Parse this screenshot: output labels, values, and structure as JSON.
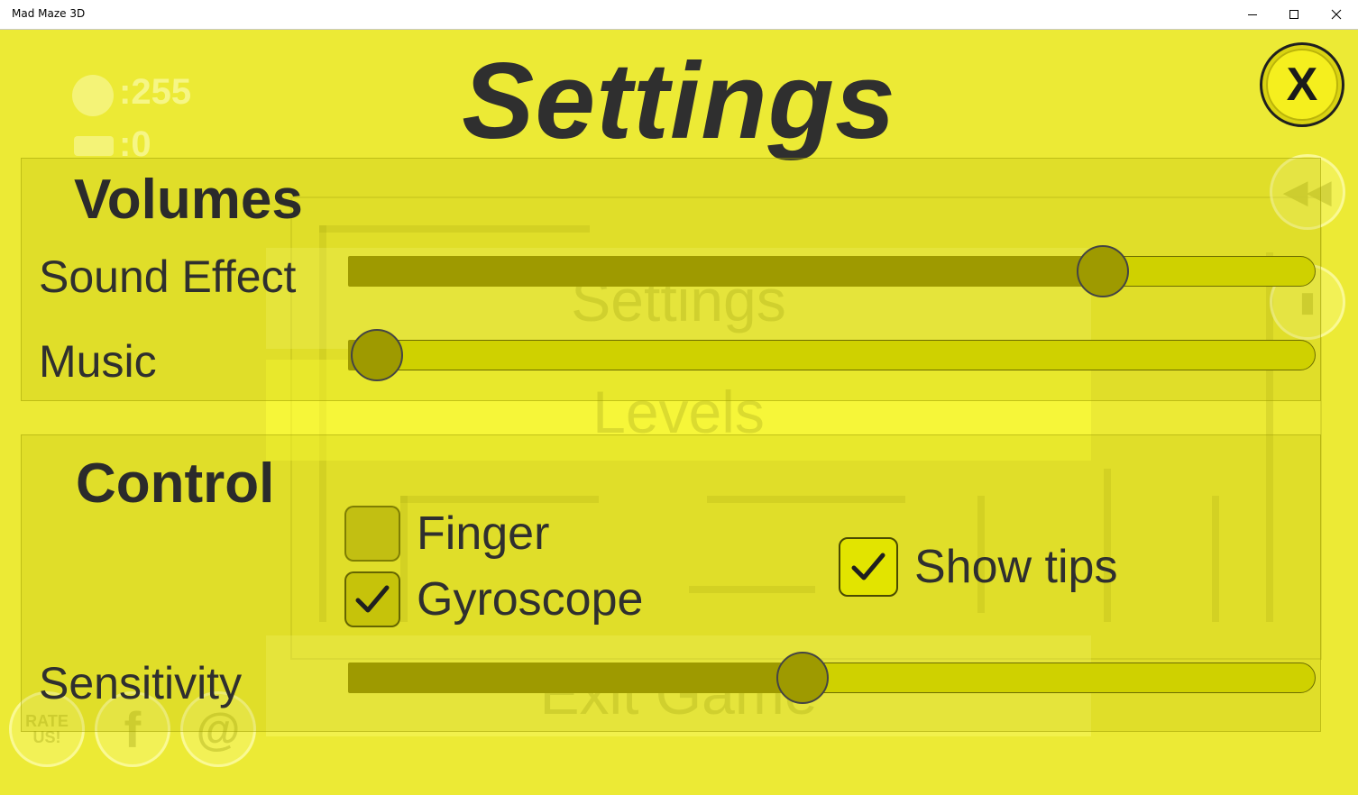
{
  "window": {
    "title": "Mad Maze 3D",
    "minimize_icon": "minimize-icon",
    "maximize_icon": "maximize-icon",
    "close_icon": "close-icon"
  },
  "background_menu": {
    "coins_value": ":255",
    "keys_value": ":0",
    "items": [
      "Settings",
      "Levels",
      "Exit Game"
    ],
    "rate_label_line1": "RATE",
    "rate_label_line2": "US!",
    "facebook_label": "f",
    "email_label": "@"
  },
  "settings": {
    "title": "Settings",
    "close_label": "X",
    "volumes": {
      "title": "Volumes",
      "sound_effect_label": "Sound Effect",
      "sound_effect_value": 0.78,
      "music_label": "Music",
      "music_value": 0.03
    },
    "control": {
      "title": "Control",
      "finger_label": "Finger",
      "finger_checked": false,
      "gyroscope_label": "Gyroscope",
      "gyroscope_checked": true,
      "show_tips_label": "Show tips",
      "show_tips_checked": true,
      "sensitivity_label": "Sensitivity",
      "sensitivity_value": 0.47
    }
  },
  "colors": {
    "background": "#ecea35",
    "slider_fill": "#9e9a00",
    "slider_track": "#cfd100",
    "text": "#2f2f2f"
  }
}
